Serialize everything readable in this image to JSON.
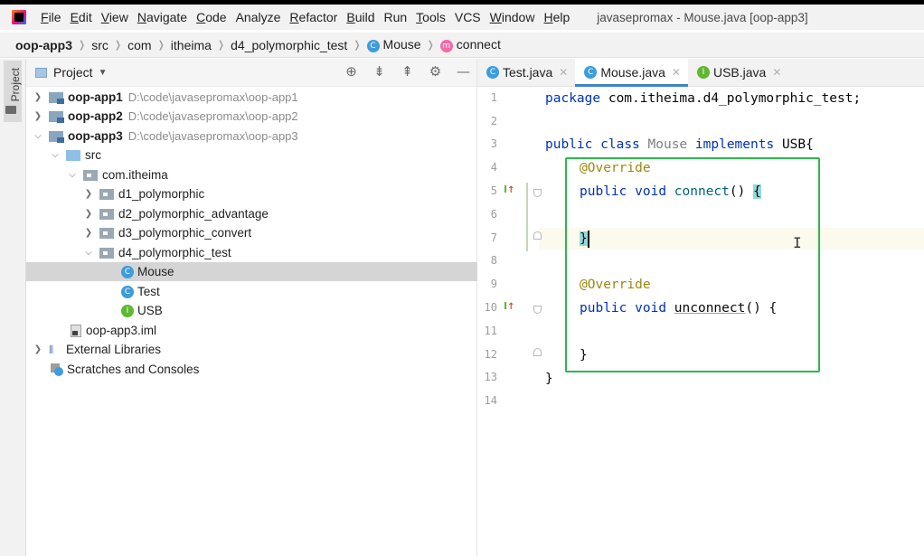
{
  "menu": {
    "items": [
      {
        "label": "File",
        "mnemonic": "F",
        "rest": "ile"
      },
      {
        "label": "Edit",
        "mnemonic": "E",
        "rest": "dit"
      },
      {
        "label": "View",
        "mnemonic": "V",
        "rest": "iew"
      },
      {
        "label": "Navigate",
        "mnemonic": "N",
        "rest": "avigate"
      },
      {
        "label": "Code",
        "mnemonic": "C",
        "rest": "ode"
      },
      {
        "label": "Analyze",
        "mnemonic": "",
        "rest": "Analyze"
      },
      {
        "label": "Refactor",
        "mnemonic": "R",
        "rest": "efactor"
      },
      {
        "label": "Build",
        "mnemonic": "B",
        "rest": "uild"
      },
      {
        "label": "Run",
        "mnemonic": "",
        "rest": "Run"
      },
      {
        "label": "Tools",
        "mnemonic": "T",
        "rest": "ools"
      },
      {
        "label": "VCS",
        "mnemonic": "",
        "rest": "VCS"
      },
      {
        "label": "Window",
        "mnemonic": "W",
        "rest": "indow"
      },
      {
        "label": "Help",
        "mnemonic": "H",
        "rest": "elp"
      }
    ],
    "window_title": "javasepromax - Mouse.java [oop-app3]"
  },
  "breadcrumb": {
    "project": "oop-app3",
    "src": "src",
    "com": "com",
    "itheima": "itheima",
    "package": "d4_polymorphic_test",
    "class": "Mouse",
    "method": "connect",
    "class_icon": "C",
    "method_icon": "m"
  },
  "stripe": {
    "label": "Project"
  },
  "project_panel": {
    "title": "Project",
    "tree": {
      "app1": {
        "name": "oop-app1",
        "path": "D:\\code\\javasepromax\\oop-app1"
      },
      "app2": {
        "name": "oop-app2",
        "path": "D:\\code\\javasepromax\\oop-app2"
      },
      "app3": {
        "name": "oop-app3",
        "path": "D:\\code\\javasepromax\\oop-app3"
      },
      "src": "src",
      "com_itheima": "com.itheima",
      "d1": "d1_polymorphic",
      "d2": "d2_polymorphic_advantage",
      "d3": "d3_polymorphic_convert",
      "d4": "d4_polymorphic_test",
      "mouse": "Mouse",
      "test": "Test",
      "usb": "USB",
      "iml": "oop-app3.iml",
      "libs": "External Libraries",
      "scratches": "Scratches and Consoles"
    }
  },
  "editor": {
    "tabs": [
      {
        "label": "Test.java",
        "icon": "C"
      },
      {
        "label": "Mouse.java",
        "icon": "C"
      },
      {
        "label": "USB.java",
        "icon": "I"
      }
    ],
    "line_numbers": [
      "1",
      "2",
      "3",
      "4",
      "5",
      "6",
      "7",
      "8",
      "9",
      "10",
      "11",
      "12",
      "13",
      "14"
    ],
    "code": {
      "l1_kw": "package",
      "l1_rest": " com.itheima.d4_polymorphic_test;",
      "l3_kw1": "public",
      "l3_kw2": "class",
      "l3_cls": "Mouse",
      "l3_kw3": "implements",
      "l3_rest": " USB{",
      "l4_ann": "@Override",
      "l5_kw1": "public",
      "l5_kw2": "void",
      "l5_fn": "connect",
      "l5_paren": "() ",
      "l5_brace": "{",
      "l7_brace": "}",
      "l9_ann": "@Override",
      "l10_kw1": "public",
      "l10_kw2": "void",
      "l10_fn": "unconnect",
      "l10_rest": "() {",
      "l12_brace": "}",
      "l13_brace": "}"
    },
    "gutter_marks": {
      "implements_glyph": "I",
      "up_arrow": "↑"
    }
  }
}
